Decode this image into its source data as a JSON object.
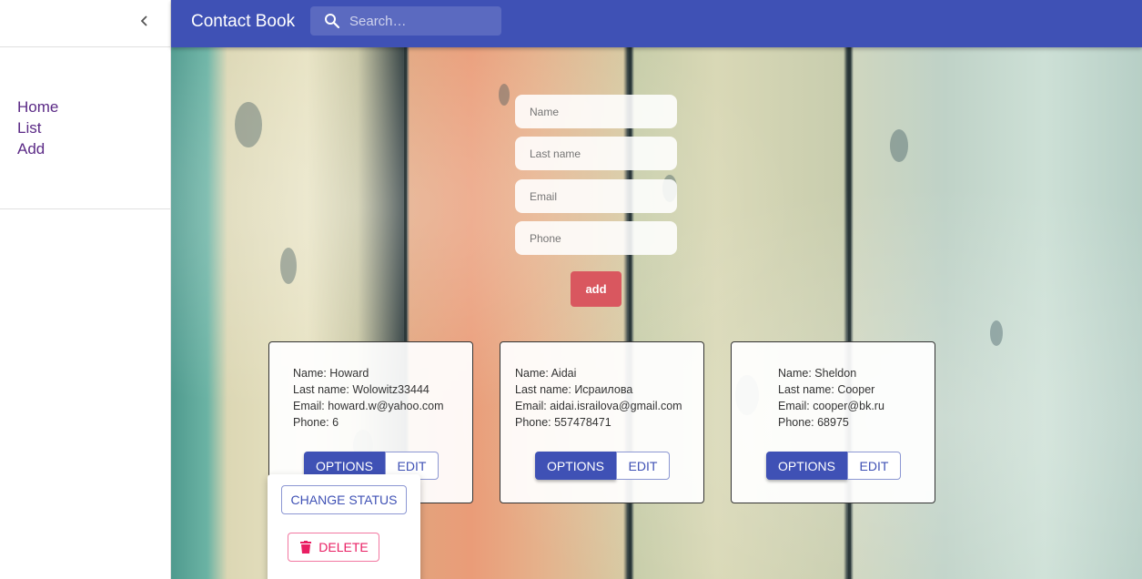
{
  "sidebar": {
    "collapse_icon": "chevron-left-icon",
    "nav": [
      {
        "label": "Home"
      },
      {
        "label": "List"
      },
      {
        "label": "Add"
      }
    ]
  },
  "appbar": {
    "title": "Contact Book",
    "search": {
      "placeholder": "Search…",
      "icon": "search-icon"
    }
  },
  "form": {
    "name_placeholder": "Name",
    "last_name_placeholder": "Last name",
    "email_placeholder": "Email",
    "phone_placeholder": "Phone",
    "add_label": "add"
  },
  "contacts": [
    {
      "name": "Name: Howard",
      "last_name": "Last name: Wolowitz33444",
      "email": "Email: howard.w@yahoo.com",
      "phone": "Phone: 6",
      "options_label": "OPTIONS",
      "edit_label": "EDIT"
    },
    {
      "name": "Name: Aidai",
      "last_name": "Last name: Исраилова",
      "email": "Email: aidai.israilova@gmail.com",
      "phone": "Phone: 557478471",
      "options_label": "OPTIONS",
      "edit_label": "EDIT"
    },
    {
      "name": "Name: Sheldon",
      "last_name": "Last name: Cooper",
      "email": "Email: cooper@bk.ru",
      "phone": "Phone: 68975",
      "options_label": "OPTIONS",
      "edit_label": "EDIT"
    }
  ],
  "options_menu": {
    "change_status_label": "CHANGE STATUS",
    "delete_label": "DELETE",
    "delete_icon": "trash-icon"
  },
  "colors": {
    "primary": "#3f51b5",
    "add_button": "#d9575f",
    "delete": "#e91e63",
    "nav_link": "#5b2a86"
  }
}
